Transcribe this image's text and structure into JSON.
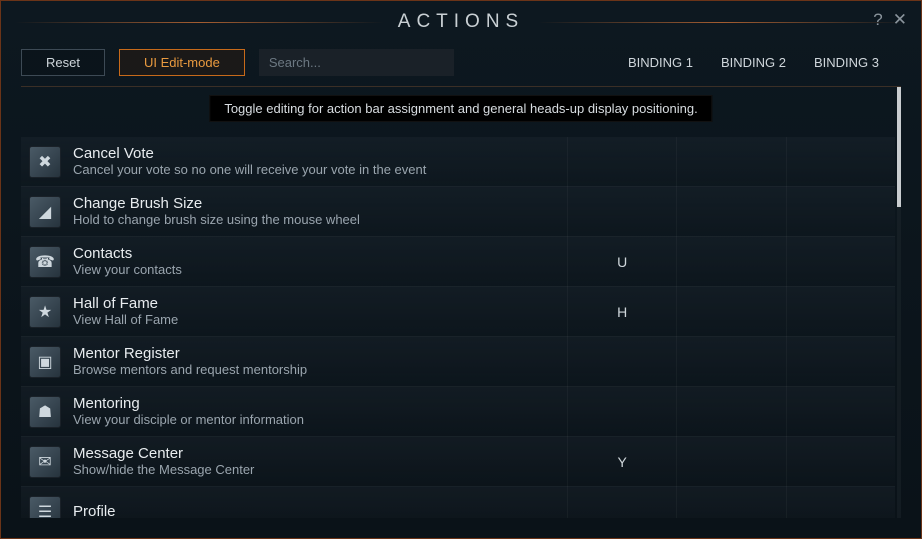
{
  "title": "ACTIONS",
  "toolbar": {
    "reset_label": "Reset",
    "edit_label": "UI Edit-mode",
    "search_placeholder": "Search..."
  },
  "columns": {
    "b1": "BINDING 1",
    "b2": "BINDING 2",
    "b3": "BINDING 3"
  },
  "tooltip": "Toggle editing for action bar assignment and general heads-up display positioning.",
  "actions": [
    {
      "name": "Cancel Vote",
      "desc": "Cancel your vote so no one will receive your vote in the event",
      "glyph": "✖",
      "b1": "",
      "b2": "",
      "b3": ""
    },
    {
      "name": "Change Brush Size",
      "desc": "Hold to change brush size using the mouse wheel",
      "glyph": "◢",
      "b1": "",
      "b2": "",
      "b3": ""
    },
    {
      "name": "Contacts",
      "desc": "View your contacts",
      "glyph": "☎",
      "b1": "U",
      "b2": "",
      "b3": ""
    },
    {
      "name": "Hall of Fame",
      "desc": "View Hall of Fame",
      "glyph": "★",
      "b1": "H",
      "b2": "",
      "b3": ""
    },
    {
      "name": "Mentor Register",
      "desc": "Browse mentors and request mentorship",
      "glyph": "▣",
      "b1": "",
      "b2": "",
      "b3": ""
    },
    {
      "name": "Mentoring",
      "desc": "View your disciple or mentor information",
      "glyph": "☗",
      "b1": "",
      "b2": "",
      "b3": ""
    },
    {
      "name": "Message Center",
      "desc": "Show/hide the Message Center",
      "glyph": "✉",
      "b1": "Y",
      "b2": "",
      "b3": ""
    },
    {
      "name": "Profile",
      "desc": "",
      "glyph": "☰",
      "b1": "",
      "b2": "",
      "b3": ""
    }
  ]
}
